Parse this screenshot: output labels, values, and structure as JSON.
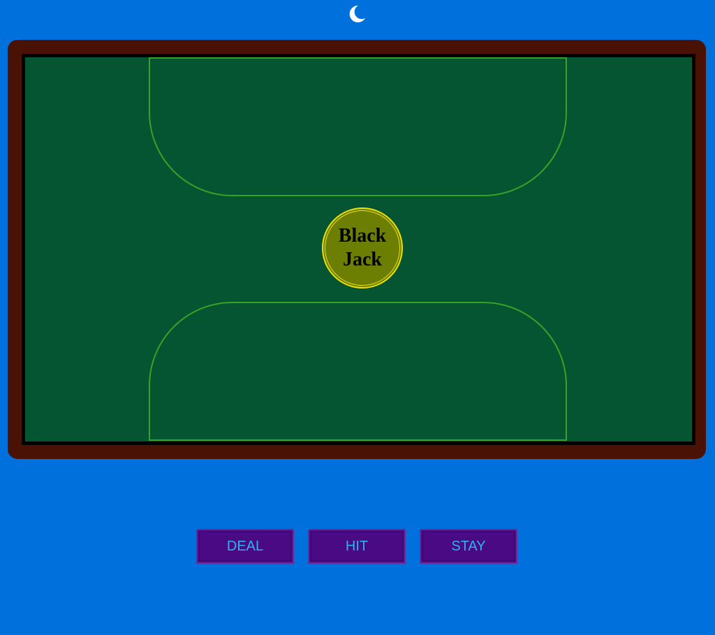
{
  "header": {
    "theme_toggle_icon": "moon-icon"
  },
  "table": {
    "logo_line1": "Black",
    "logo_line2": "Jack",
    "colors": {
      "background": "#0070dc",
      "rail": "#4a1204",
      "felt": "#055533",
      "area_line": "#3aa222",
      "chip_fill": "#6c7f02",
      "chip_ring": "#f0e000"
    }
  },
  "controls": {
    "deal_label": "DEAL",
    "hit_label": "HIT",
    "stay_label": "STAY",
    "colors": {
      "button_bg": "#4a0a84",
      "button_text": "#2ab4f0"
    }
  }
}
